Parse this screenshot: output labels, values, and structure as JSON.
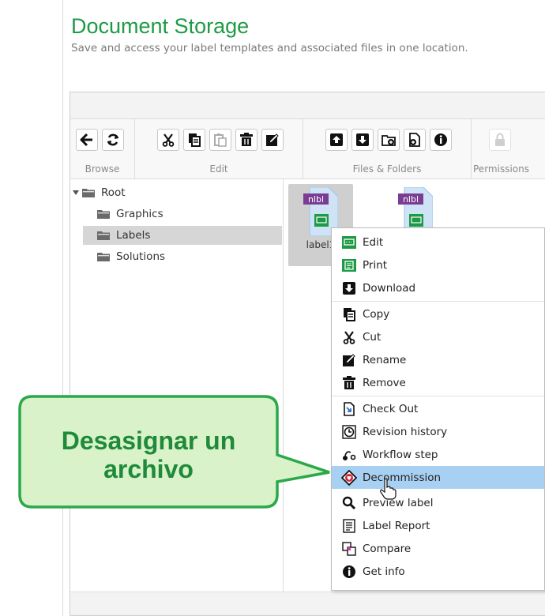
{
  "header": {
    "title": "Document Storage",
    "subtitle": "Save and access your label templates and associated files in one location."
  },
  "ribbon": {
    "browse_label": "Browse",
    "edit_label": "Edit",
    "files_folders_label": "Files & Folders",
    "permissions_label": "Permissions",
    "icons": {
      "browse": [
        "arrow-left-icon",
        "refresh-icon"
      ],
      "edit": [
        "cut-icon",
        "copy-icon",
        "paste-icon",
        "delete-icon",
        "rename-icon"
      ],
      "files": [
        "upload-icon",
        "download-icon",
        "new-folder-icon",
        "add-file-icon",
        "info-icon"
      ],
      "permissions": [
        "lock-icon"
      ]
    }
  },
  "tree": {
    "root": "Root",
    "items": [
      "Graphics",
      "Labels",
      "Solutions"
    ],
    "selected": "Labels"
  },
  "files": {
    "tile_badge": "nlbl",
    "items": [
      {
        "name": "label1"
      },
      {
        "name": ""
      }
    ]
  },
  "context_menu": {
    "items": [
      {
        "label": "Edit",
        "icon": "edit-label-icon"
      },
      {
        "label": "Print",
        "icon": "print-label-icon"
      },
      {
        "label": "Download",
        "icon": "download-icon"
      },
      {
        "label": "Copy",
        "icon": "copy-icon"
      },
      {
        "label": "Cut",
        "icon": "cut-icon"
      },
      {
        "label": "Rename",
        "icon": "rename-icon"
      },
      {
        "label": "Remove",
        "icon": "delete-icon"
      },
      {
        "label": "Check Out",
        "icon": "check-out-icon"
      },
      {
        "label": "Revision history",
        "icon": "revision-history-icon"
      },
      {
        "label": "Workflow step",
        "icon": "workflow-icon"
      },
      {
        "label": "Decommission",
        "icon": "decommission-icon"
      },
      {
        "label": "Preview label",
        "icon": "preview-icon"
      },
      {
        "label": "Label Report",
        "icon": "report-icon"
      },
      {
        "label": "Compare",
        "icon": "compare-icon"
      },
      {
        "label": "Get info",
        "icon": "info-icon"
      }
    ],
    "highlighted": "Decommission"
  },
  "callout": {
    "line1": "Desasignar un",
    "line2": "archivo"
  },
  "colors": {
    "brand_green": "#1d9a45",
    "callout_fill": "#d9f2c9",
    "callout_border": "#2aa84a",
    "highlight": "#a8d0f2",
    "nlbl_purple": "#7a3d94"
  }
}
